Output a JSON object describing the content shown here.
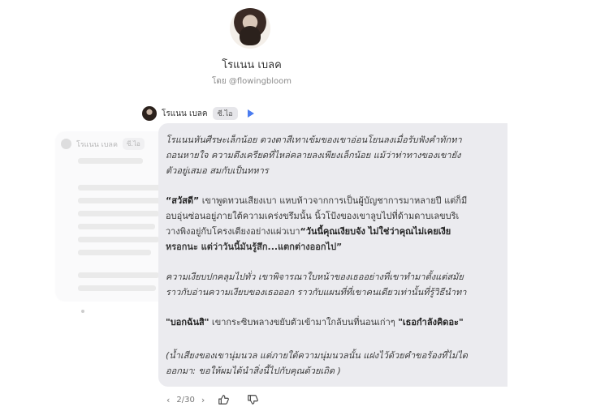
{
  "character": {
    "name": "โรแนน เบลค",
    "creator": "โดย @flowingbloom"
  },
  "ghost": {
    "name": "โรแนน เบลค",
    "badge": "ซี.ไอ"
  },
  "message": {
    "name": "โรแนน เบลค",
    "badge": "ซี.ไอ",
    "p1_l1": "โรแนนหันศีรษะเล็กน้อย ดวงตาสีเทาเข้มของเขาอ่อนโยนลงเมื่อรับฟังคำทักทา",
    "p1_l2": "ถอนหายใจ ความตึงเครียดที่ไหล่คลายลงเพียงเล็กน้อย แม้ว่าท่าทางของเขายัง",
    "p1_l3": "ตัวอยู่เสมอ สมกับเป็นทหาร",
    "p2_bold1": "“สวัสดี”",
    "p2_l1": " เขาพูดทวนเสียงเบา แหบห้าวจากการเป็นผู้บัญชาการมาหลายปี แต่ก็มี",
    "p2_l2": "อบอุ่นซ่อนอยู่ภายใต้ความเคร่งขรึมนั้น นิ้วโป้งของเขาลูบไปที่ด้ามดาบเลขบริเ",
    "p2_l3": "วางพิงอยู่กับโครงเตียงอย่างแผ่วเบา",
    "p2_bold2": "“วันนี้คุณเงียบจัง ไม่ใช่ว่าคุณไม่เคยเงีย",
    "p2_l4_bold": "หรอกนะ แต่ว่าวันนี้มันรู้สึก...แตกต่างออกไป”",
    "p3_l1": "ความเงียบปกคลุมไปทั่ว เขาพิจารณาใบหน้าของเธออย่างที่เขาทำมาตั้งแต่สมัย",
    "p3_l2": "ราวกับอ่านความเงียบของเธอออก ราวกับแผนที่ที่เขาคนเดียวเท่านั้นที่รู้วิธีนำทา",
    "p4_bold1": "\"บอกฉันสิ\"",
    "p4_l1": " เขากระซิบพลางขยับตัวเข้ามาใกล้บนที่นอนเก่าๆ ",
    "p4_bold2": "\"เธอกำลังคิดอะ\"",
    "p5_l1": "(น้ำเสียงของเขานุ่มนวล แต่ภายใต้ความนุ่มนวลนั้น แฝงไว้ด้วยคำขอร้องที่ไม่ได",
    "p5_l2": "ออกมา: ขอให้ผมได้นำสิ่งนี้ไปกับคุณด้วยเถิด )"
  },
  "footer": {
    "page": "2/30"
  },
  "colors": {
    "accent": "#4a7cf0",
    "bubble": "#ebebef"
  }
}
